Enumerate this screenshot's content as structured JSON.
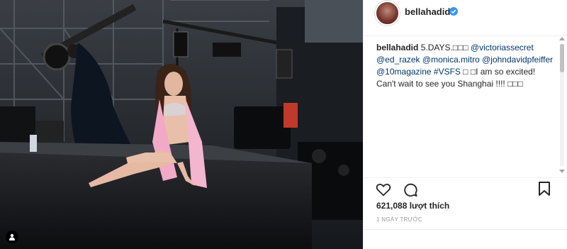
{
  "post": {
    "username": "bellahadid",
    "caption_user": "bellahadid",
    "caption": {
      "t1": "5.DAYS.□□□ ",
      "m1": "@victoriassecret",
      "m2": "@ed_razek",
      "m3": "@monica.mitro",
      "m4": "@johndavidpfeiffer",
      "m5": "@10magazine",
      "m6": "#VSFS",
      "t2": " □ □I am so excited! Can't wait to see you Shanghai !!!! □□□"
    },
    "likes": "621,088 lượt thích",
    "time": "1 NGÀY TRƯỚC"
  },
  "icons": {
    "verified": "verified-badge-icon",
    "heart": "heart-icon",
    "comment": "comment-icon",
    "bookmark": "bookmark-icon",
    "user_tag": "user-tag-icon"
  },
  "colors": {
    "verified_blue": "#3897f0",
    "mention_link": "#003569",
    "text": "#262626",
    "muted": "#999999"
  }
}
